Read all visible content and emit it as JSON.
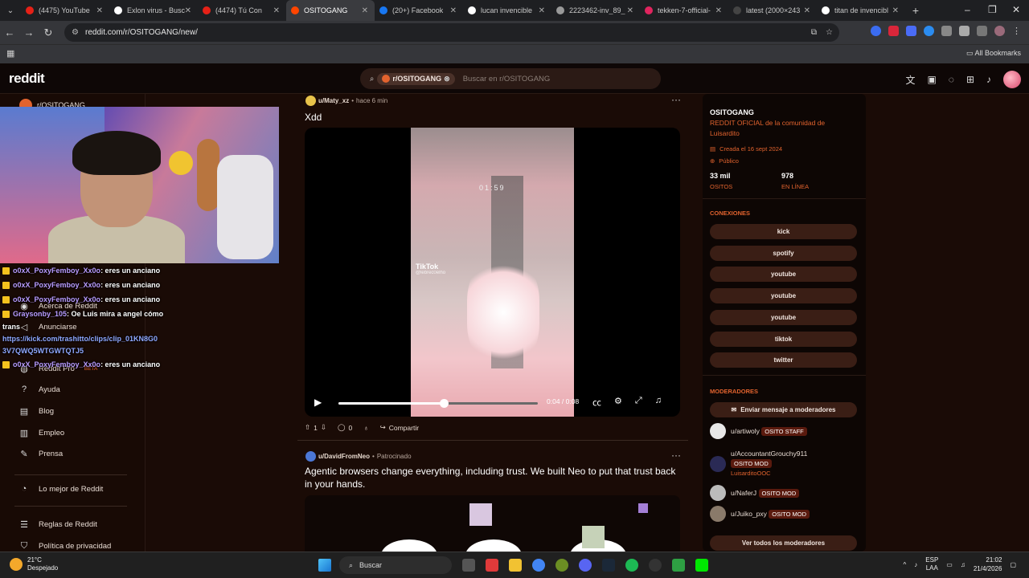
{
  "browser": {
    "tabs": [
      {
        "label": "(4475) YouTube",
        "color": "#e62117",
        "active": false
      },
      {
        "label": "Exlon virus - Busc",
        "color": "#ffffff",
        "active": false
      },
      {
        "label": "(4474) Tú Con",
        "color": "#e62117",
        "active": false
      },
      {
        "label": "OSITOGANG",
        "color": "#ff4500",
        "active": true
      },
      {
        "label": "(20+) Facebook",
        "color": "#1877f2",
        "active": false
      },
      {
        "label": "lucan invencible",
        "color": "#ffffff",
        "active": false
      },
      {
        "label": "2223462-inv_89_",
        "color": "#999999",
        "active": false
      },
      {
        "label": "tekken-7-official-",
        "color": "#e0245e",
        "active": false
      },
      {
        "label": "latest (2000×243",
        "color": "#444444",
        "active": false
      },
      {
        "label": "titan de invencibl",
        "color": "#ffffff",
        "active": false
      }
    ],
    "url": "reddit.com/r/OSITOGANG/new/",
    "bookmarks_label": "All Bookmarks"
  },
  "header": {
    "logo": "reddit",
    "search_chip": "r/OSITOGANG",
    "search_placeholder": "Buscar en r/OSITOGANG"
  },
  "leftnav": {
    "community": "r/OSITOGANG",
    "items": [
      {
        "label": "Acerca de Reddit",
        "icon": "reddit-icon"
      },
      {
        "label": "Anunciarse",
        "icon": "megaphone-icon"
      },
      {
        "label": "Reddit Pro",
        "icon": "pro-icon",
        "badge": "BETA"
      },
      {
        "label": "Ayuda",
        "icon": "help-icon"
      },
      {
        "label": "Blog",
        "icon": "book-icon"
      },
      {
        "label": "Empleo",
        "icon": "briefcase-icon"
      },
      {
        "label": "Prensa",
        "icon": "mic-icon"
      },
      {
        "label": "Lo mejor de Reddit",
        "icon": "trophy-icon"
      },
      {
        "label": "Reglas de Reddit",
        "icon": "rules-icon"
      },
      {
        "label": "Política de privacidad",
        "icon": "shield-icon"
      }
    ]
  },
  "chat": {
    "lines": [
      {
        "user": "o0xX_PoxyFemboy_Xx0o",
        "text": ": eres un anciano"
      },
      {
        "user": "o0xX_PoxyFemboy_Xx0o",
        "text": ": eres un anciano"
      },
      {
        "user": "o0xX_PoxyFemboy_Xx0o",
        "text": ": eres un anciano"
      },
      {
        "user": "Graysonby_105",
        "text": ": Oe Luis mira a angel cómo"
      }
    ],
    "wrap": "trans",
    "link1": "https://kick.com/trashitto/clips/clip_01KN8G0",
    "link2": "3V7QWQ5WTGWTQTJ5",
    "last": {
      "user": "o0xX_PoxyFemboy_Xx0o",
      "text": ": eres un anciano"
    }
  },
  "post1": {
    "user": "u/Maty_xz",
    "time": "hace 6 min",
    "title": "Xdd",
    "video": {
      "timer_overlay": "01:59",
      "watermark": "TikTok",
      "handle": "@lebrec0elho",
      "time": "0:04 / 0:08",
      "progress": 0.53
    },
    "votes": "1",
    "comments": "0",
    "share": "Compartir"
  },
  "post2": {
    "user": "u/DavidFromNeo",
    "promoted": "Patrocinado",
    "title": "Agentic browsers change everything, including trust. We built Neo to put that trust back in your hands."
  },
  "sidebar": {
    "title": "OSITOGANG",
    "description": "REDDIT OFICIAL de la comunidad de Luisardito",
    "created": "Creada el 16 sept 2024",
    "visibility": "Público",
    "members_value": "33 mil",
    "members_label": "OSITOS",
    "online_value": "978",
    "online_label": "EN LÍNEA",
    "connections_heading": "CONEXIONES",
    "connections": [
      "kick",
      "spotify",
      "youtube",
      "youtube",
      "youtube",
      "tiktok",
      "twitter"
    ],
    "mods_heading": "MODERADORES",
    "message_mods": "Enviar mensaje a moderadores",
    "mods": [
      {
        "name": "u/artiwoly",
        "flair": "OSITO STAFF",
        "sub": ""
      },
      {
        "name": "u/AccountantGrouchy911",
        "flair": "OSITO MOD",
        "sub": "LuisarditoOOC"
      },
      {
        "name": "u/NaferJ",
        "flair": "OSITO MOD",
        "sub": ""
      },
      {
        "name": "u/Juiko_pxy",
        "flair": "OSITO MOD",
        "sub": ""
      }
    ],
    "view_all_mods": "Ver todos los moderadores"
  },
  "taskbar": {
    "temp": "21°C",
    "weather": "Despejado",
    "search": "Buscar",
    "lang": "ESP",
    "region": "LAA",
    "time": "21:02",
    "date": "21/4/2026"
  },
  "colors": {
    "accent": "#e2632e",
    "background": "#1a0b06",
    "reddit_orange": "#ff4500"
  }
}
